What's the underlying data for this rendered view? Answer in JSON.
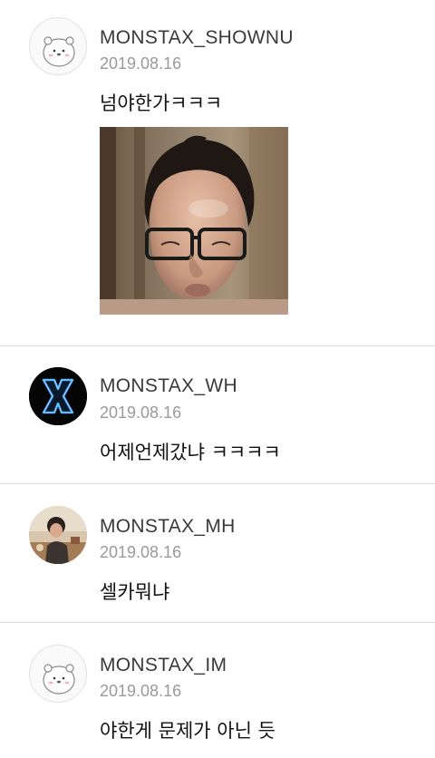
{
  "comments": [
    {
      "username": "MONSTAX_SHOWNU",
      "date": "2019.08.16",
      "text": "넘야한가ㅋㅋㅋ",
      "avatar": "bear-sticker-icon",
      "has_photo": true,
      "photo": "selfie-photo"
    },
    {
      "username": "MONSTAX_WH",
      "date": "2019.08.16",
      "text": "어제언제갔냐 ㅋㅋㅋㅋ",
      "avatar": "neon-x-logo-icon"
    },
    {
      "username": "MONSTAX_MH",
      "date": "2019.08.16",
      "text": "셀카뭐냐",
      "avatar": "profile-photo-avatar"
    },
    {
      "username": "MONSTAX_IM",
      "date": "2019.08.16",
      "text": "야한게 문제가 아닌 듯",
      "avatar": "bear-sticker-icon"
    }
  ],
  "colors": {
    "username": "#3a3a3a",
    "date": "#9a9a9a",
    "comment": "#111111",
    "divider": "#dcdcdc",
    "neon_blue": "#3fa0ff"
  }
}
